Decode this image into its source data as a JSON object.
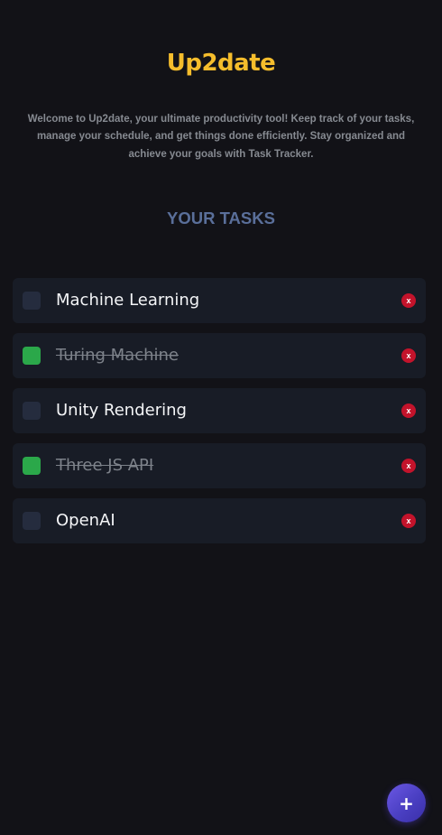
{
  "app": {
    "title": "Up2date",
    "intro": "Welcome to Up2date, your ultimate productivity tool! Keep track of your tasks, manage your schedule, and get things done efficiently. Stay organized and achieve your goals with Task Tracker."
  },
  "tasks_section": {
    "heading": "YOUR TASKS"
  },
  "tasks": [
    {
      "label": "Machine Learning",
      "completed": false
    },
    {
      "label": "Turing Machine",
      "completed": true
    },
    {
      "label": "Unity Rendering",
      "completed": false
    },
    {
      "label": "Three JS API",
      "completed": true
    },
    {
      "label": "OpenAI",
      "completed": false
    }
  ],
  "delete_label": "x",
  "fab": {
    "label": "+",
    "icon": "plus-icon"
  },
  "colors": {
    "background": "#121217",
    "title": "#f5bd2c",
    "heading": "#5a6f9a",
    "task_card": "#181c26",
    "checkbox_unchecked": "#252c3e",
    "checkbox_checked": "#2ba84a",
    "delete": "#c3132b",
    "fab_gradient_start": "#6b58e4",
    "fab_gradient_end": "#3a2fa8"
  }
}
